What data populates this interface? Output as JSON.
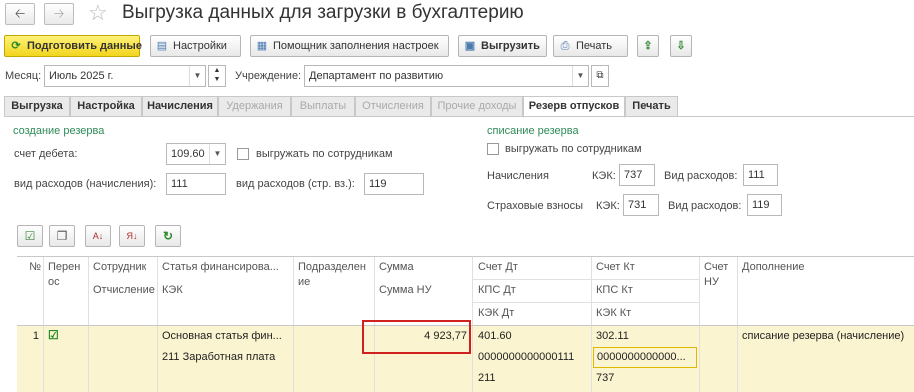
{
  "window": {
    "title": "Выгрузка данных для загрузки в бухгалтерию"
  },
  "toolbar": {
    "prepare_label": "Подготовить данные",
    "settings_label": "Настройки",
    "wizard_label": "Помощник заполнения настроек",
    "export_label": "Выгрузить",
    "print_label": "Печать"
  },
  "filters": {
    "month_label": "Месяц:",
    "month_value": "Июль 2025 г.",
    "org_label": "Учреждение:",
    "org_value": "Департамент по развитию"
  },
  "tabs": [
    {
      "label": "Выгрузка"
    },
    {
      "label": "Настройка"
    },
    {
      "label": "Начисления"
    },
    {
      "label": "Удержания"
    },
    {
      "label": "Выплаты"
    },
    {
      "label": "Отчисления"
    },
    {
      "label": "Прочие доходы"
    },
    {
      "label": "Резерв отпусков"
    },
    {
      "label": "Печать"
    }
  ],
  "reserve": {
    "create_title": "создание резерва",
    "debit_label": "счет дебета:",
    "debit_value": "109.60",
    "per_employee_label": "выгружать по сотрудникам",
    "expense_type_label": "вид расходов  (начисления):",
    "expense_type_value": "111",
    "expense_type_ins_label": "вид расходов (стр. вз.):",
    "expense_type_ins_value": "119",
    "write_off_title": "списание резерва",
    "wo_per_employee_label": "выгружать по сотрудникам",
    "accruals_label": "Начисления",
    "kek_label": "КЭК:",
    "accruals_kek": "737",
    "exp_label": "Вид расходов:",
    "accruals_exp": "111",
    "ins_label": "Страховые взносы",
    "ins_kek": "731",
    "ins_exp": "119"
  },
  "table": {
    "headers": {
      "num": "№",
      "transfer_1": "Перен",
      "transfer_2": "ос",
      "employee": "Сотрудник",
      "deduction": "Отчисление",
      "fin_article": "Статья финансирова...",
      "kek": "КЭК",
      "division_1": "Подразделен",
      "division_2": "ие",
      "amount": "Сумма",
      "amount_nu": "Сумма НУ",
      "acc_dt": "Счет Дт",
      "kps_dt": "КПС Дт",
      "kek_dt": "КЭК Дт",
      "acc_kt": "Счет Кт",
      "kps_kt": "КПС Кт",
      "kek_kt": "КЭК Кт",
      "acc_nu_1": "Счет",
      "acc_nu_2": "НУ",
      "extra": "Дополнение"
    },
    "rows": [
      {
        "num": "1",
        "fin_article": "Основная статья фин...",
        "kek": "211 Заработная плата",
        "amount_nu": "4 923,77",
        "acc_dt": "401.60",
        "kps_dt": "0000000000000111",
        "kek_dt": "211",
        "acc_kt": "302.11",
        "kps_kt": "0000000000000...",
        "kek_kt": "737",
        "extra": "списание резерва (начисление)"
      }
    ]
  }
}
